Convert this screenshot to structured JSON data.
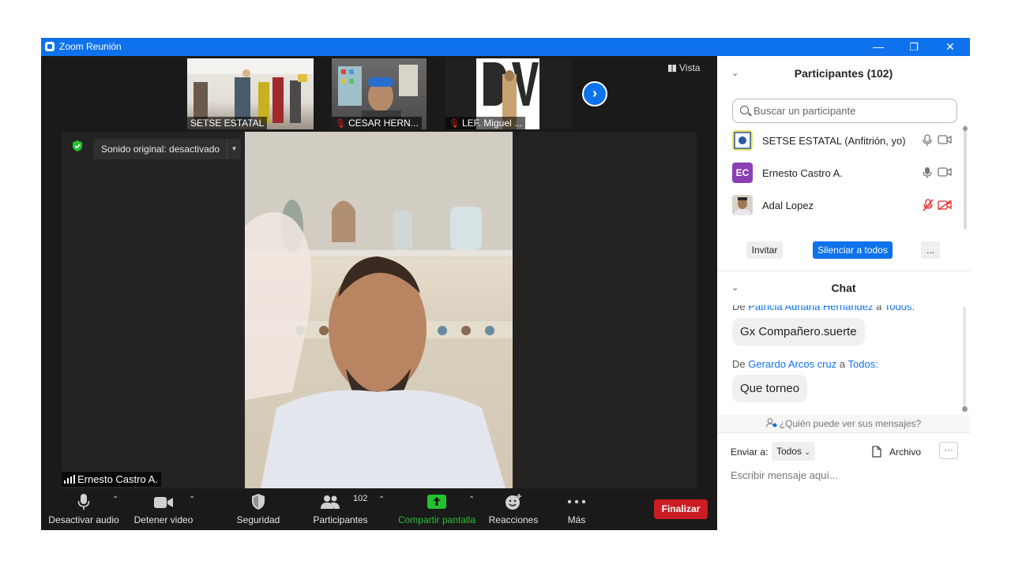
{
  "window": {
    "title": "Zoom Reunión",
    "minimize": "—",
    "restore": "❐",
    "close": "✕"
  },
  "gallery": {
    "thumbs": [
      {
        "name": "SETSE ESTATAL",
        "muted": false
      },
      {
        "name": "CESAR HERN...",
        "muted": true
      },
      {
        "name": "LEF. Miguel ...",
        "muted": true
      }
    ],
    "next": "›",
    "view_label": "Vista"
  },
  "main_video": {
    "sound_option": "Sonido original: desactivado",
    "speaker_name": "Ernesto Castro A."
  },
  "toolbar": {
    "audio": "Desactivar audio",
    "video": "Detener video",
    "security": "Seguridad",
    "participants": "Participantes",
    "participants_count": "102",
    "share": "Compartir pantalla",
    "reactions": "Reacciones",
    "more": "Más",
    "end": "Finalizar"
  },
  "participants_panel": {
    "title": "Participantes (102)",
    "search_placeholder": "Buscar un participante",
    "list": [
      {
        "name": "SETSE ESTATAL (Anfitrión, yo)",
        "avatar_initials": "",
        "muted": false,
        "video_off": false
      },
      {
        "name": "Ernesto Castro A.",
        "avatar_initials": "EC",
        "muted": false,
        "video_off": false
      },
      {
        "name": "Adal Lopez",
        "avatar_initials": "",
        "muted": true,
        "video_off": true
      }
    ],
    "invite": "Invitar",
    "mute_all": "Silenciar a todos",
    "more": "..."
  },
  "chat": {
    "title": "Chat",
    "messages": [
      {
        "from_prefix": "De",
        "sender": "Patricia Adriana Hernandez",
        "to_word": "a",
        "recipient": "Todos:",
        "text": "Gx Compañero.suerte"
      },
      {
        "from_prefix": "De",
        "sender": "Gerardo Arcos cruz",
        "to_word": "a",
        "recipient": "Todos:",
        "text": "Que torneo"
      }
    ],
    "who_can_see": "¿Quién puede ver sus mensajes?",
    "send_to_label": "Enviar a:",
    "send_to_value": "Todos",
    "file_label": "Archivo",
    "more": "···",
    "compose_placeholder": "Escribir mensaje aquí..."
  },
  "colors": {
    "accent": "#0e72ed",
    "end": "#cb1c24",
    "share": "#22c32e",
    "muted": "#e02828",
    "avatar_ec": "#8b3fb5"
  }
}
